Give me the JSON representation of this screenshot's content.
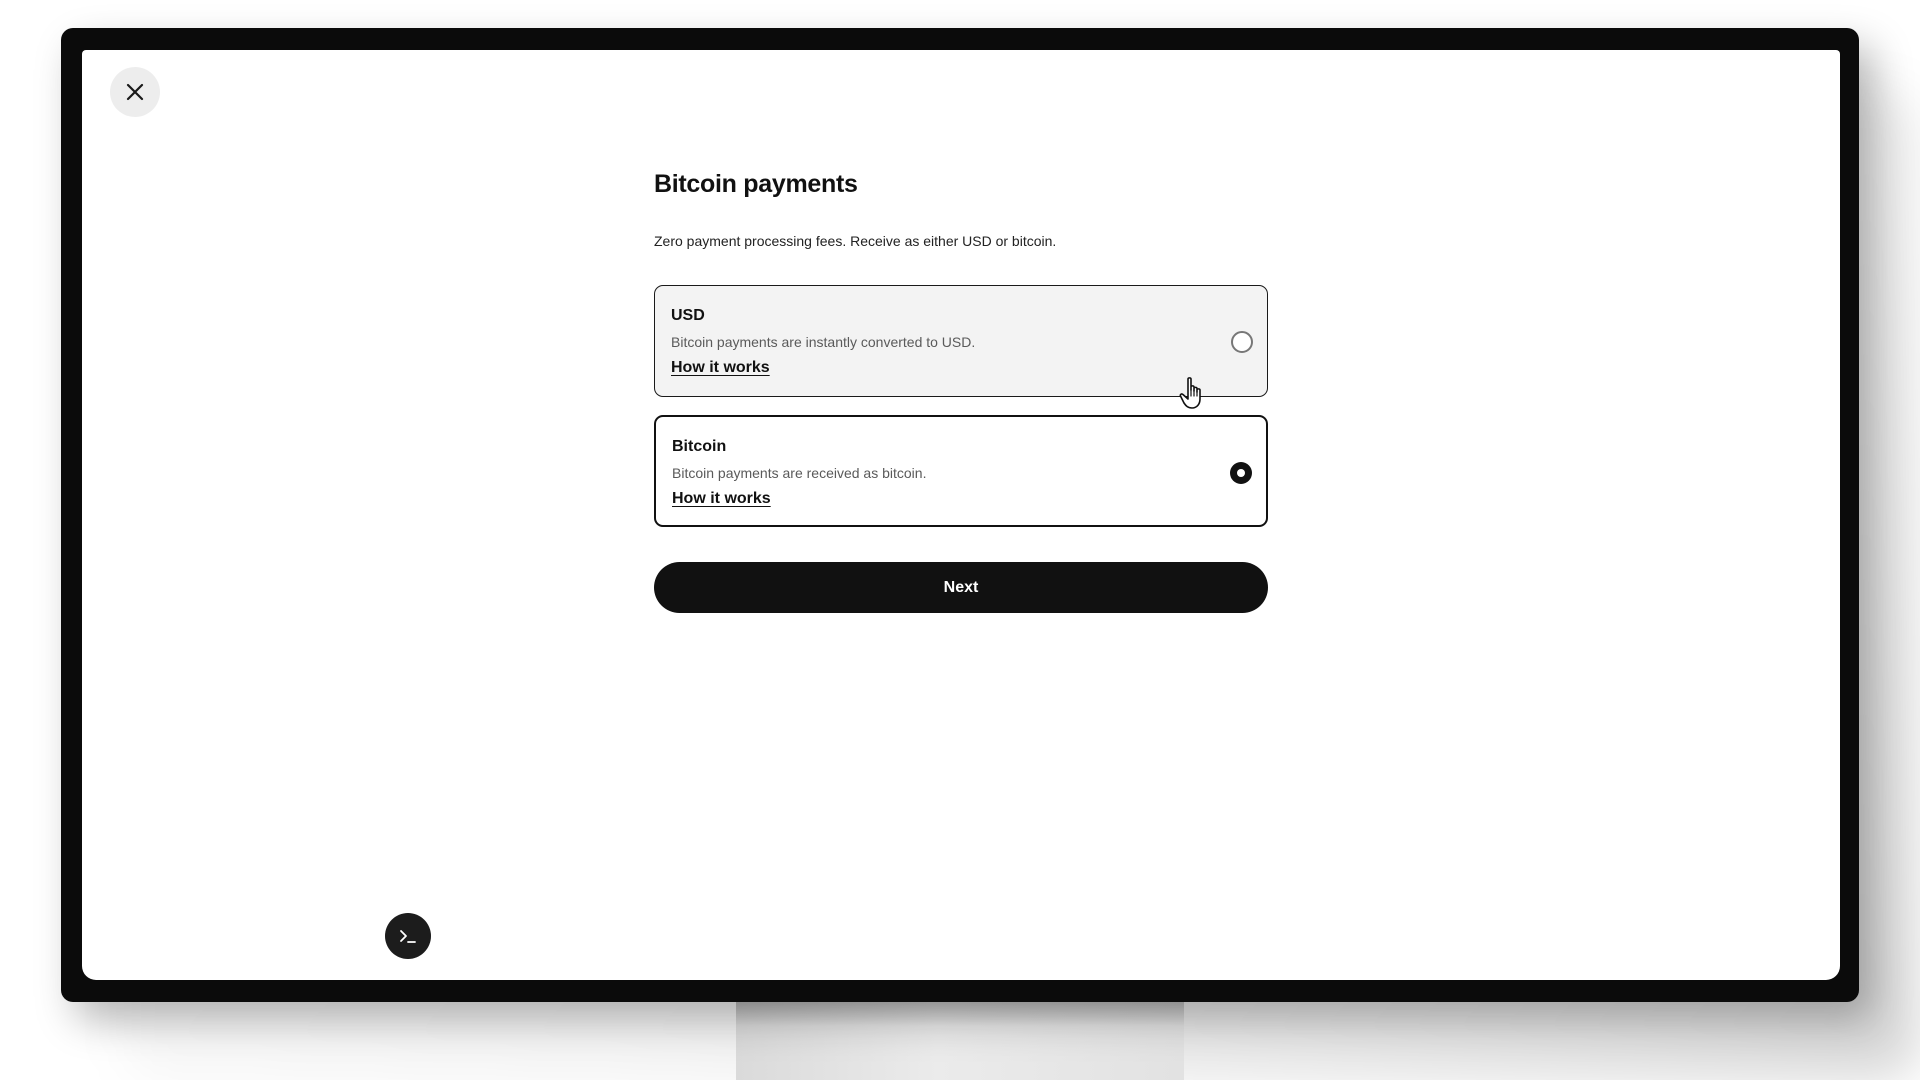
{
  "page": {
    "title": "Bitcoin payments",
    "subtitle": "Zero payment processing fees. Receive as either USD or bitcoin."
  },
  "options": [
    {
      "title": "USD",
      "description": "Bitcoin payments are instantly converted to USD.",
      "link": "How it works",
      "selected": false
    },
    {
      "title": "Bitcoin",
      "description": "Bitcoin payments are received as bitcoin.",
      "link": "How it works",
      "selected": true
    }
  ],
  "actions": {
    "next_label": "Next",
    "close_icon": "close-icon",
    "terminal_icon": "terminal-icon"
  },
  "colors": {
    "primary": "#111111",
    "card_hover_bg": "#f3f3f3",
    "muted_text": "#5a5a5a"
  }
}
